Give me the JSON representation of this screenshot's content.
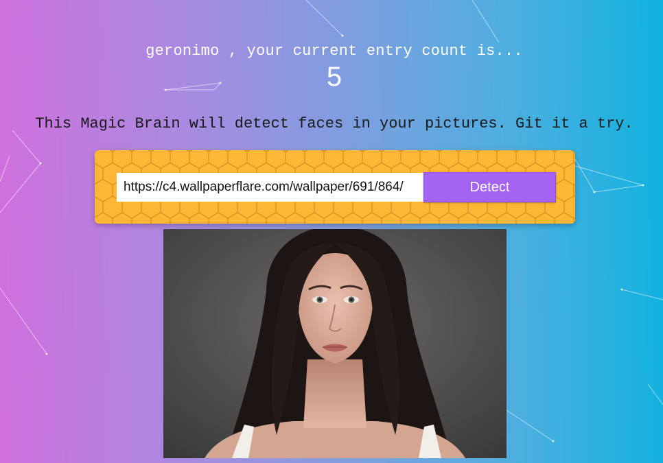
{
  "profile": {
    "greeting": "geronimo , your current entry count is...",
    "entry_count": "5"
  },
  "intro": {
    "tagline": "This Magic Brain will detect faces in your pictures. Git it a try."
  },
  "form": {
    "url_value": "https://c4.wallpaperflare.com/wallpaper/691/864/",
    "detect_label": "Detect"
  },
  "colors": {
    "gradient_start": "#d070dd",
    "gradient_end": "#10b2df",
    "form_background": "#fdb735",
    "detect_button": "#a463f2"
  }
}
